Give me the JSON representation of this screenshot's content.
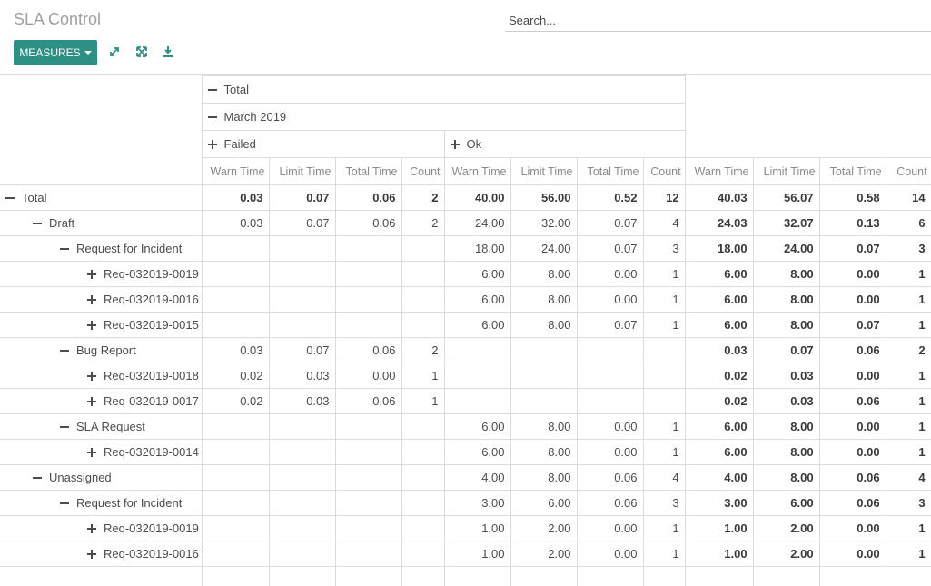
{
  "page": {
    "title": "SLA Control"
  },
  "search": {
    "placeholder": "Search..."
  },
  "toolbar": {
    "measures_label": "MEASURES"
  },
  "colors": {
    "accent": "#2e8f85"
  },
  "headers": {
    "level1": "Total",
    "level2": "March 2019",
    "groups": [
      "Failed",
      "Ok"
    ],
    "measures": [
      "Warn Time",
      "Limit Time",
      "Total Time",
      "Count"
    ]
  },
  "rows": [
    {
      "label": "Total",
      "indent": 0,
      "expanded": true,
      "failed": [
        "0.03",
        "0.07",
        "0.06",
        "2"
      ],
      "ok": [
        "40.00",
        "56.00",
        "0.52",
        "12"
      ],
      "total": [
        "40.03",
        "56.07",
        "0.58",
        "14"
      ]
    },
    {
      "label": "Draft",
      "indent": 1,
      "expanded": true,
      "failed": [
        "0.03",
        "0.07",
        "0.06",
        "2"
      ],
      "ok": [
        "24.00",
        "32.00",
        "0.07",
        "4"
      ],
      "total": [
        "24.03",
        "32.07",
        "0.13",
        "6"
      ]
    },
    {
      "label": "Request for Incident",
      "indent": 2,
      "expanded": true,
      "failed": [
        "",
        "",
        "",
        ""
      ],
      "ok": [
        "18.00",
        "24.00",
        "0.07",
        "3"
      ],
      "total": [
        "18.00",
        "24.00",
        "0.07",
        "3"
      ]
    },
    {
      "label": "Req-032019-0019",
      "indent": 3,
      "expanded": false,
      "failed": [
        "",
        "",
        "",
        ""
      ],
      "ok": [
        "6.00",
        "8.00",
        "0.00",
        "1"
      ],
      "total": [
        "6.00",
        "8.00",
        "0.00",
        "1"
      ]
    },
    {
      "label": "Req-032019-0016",
      "indent": 3,
      "expanded": false,
      "failed": [
        "",
        "",
        "",
        ""
      ],
      "ok": [
        "6.00",
        "8.00",
        "0.00",
        "1"
      ],
      "total": [
        "6.00",
        "8.00",
        "0.00",
        "1"
      ]
    },
    {
      "label": "Req-032019-0015",
      "indent": 3,
      "expanded": false,
      "failed": [
        "",
        "",
        "",
        ""
      ],
      "ok": [
        "6.00",
        "8.00",
        "0.07",
        "1"
      ],
      "total": [
        "6.00",
        "8.00",
        "0.07",
        "1"
      ]
    },
    {
      "label": "Bug Report",
      "indent": 2,
      "expanded": true,
      "failed": [
        "0.03",
        "0.07",
        "0.06",
        "2"
      ],
      "ok": [
        "",
        "",
        "",
        ""
      ],
      "total": [
        "0.03",
        "0.07",
        "0.06",
        "2"
      ]
    },
    {
      "label": "Req-032019-0018",
      "indent": 3,
      "expanded": false,
      "failed": [
        "0.02",
        "0.03",
        "0.00",
        "1"
      ],
      "ok": [
        "",
        "",
        "",
        ""
      ],
      "total": [
        "0.02",
        "0.03",
        "0.00",
        "1"
      ]
    },
    {
      "label": "Req-032019-0017",
      "indent": 3,
      "expanded": false,
      "failed": [
        "0.02",
        "0.03",
        "0.06",
        "1"
      ],
      "ok": [
        "",
        "",
        "",
        ""
      ],
      "total": [
        "0.02",
        "0.03",
        "0.06",
        "1"
      ]
    },
    {
      "label": "SLA Request",
      "indent": 2,
      "expanded": true,
      "failed": [
        "",
        "",
        "",
        ""
      ],
      "ok": [
        "6.00",
        "8.00",
        "0.00",
        "1"
      ],
      "total": [
        "6.00",
        "8.00",
        "0.00",
        "1"
      ]
    },
    {
      "label": "Req-032019-0014",
      "indent": 3,
      "expanded": false,
      "failed": [
        "",
        "",
        "",
        ""
      ],
      "ok": [
        "6.00",
        "8.00",
        "0.00",
        "1"
      ],
      "total": [
        "6.00",
        "8.00",
        "0.00",
        "1"
      ]
    },
    {
      "label": "Unassigned",
      "indent": 1,
      "expanded": true,
      "failed": [
        "",
        "",
        "",
        ""
      ],
      "ok": [
        "4.00",
        "8.00",
        "0.06",
        "4"
      ],
      "total": [
        "4.00",
        "8.00",
        "0.06",
        "4"
      ]
    },
    {
      "label": "Request for Incident",
      "indent": 2,
      "expanded": true,
      "failed": [
        "",
        "",
        "",
        ""
      ],
      "ok": [
        "3.00",
        "6.00",
        "0.06",
        "3"
      ],
      "total": [
        "3.00",
        "6.00",
        "0.06",
        "3"
      ]
    },
    {
      "label": "Req-032019-0019",
      "indent": 3,
      "expanded": false,
      "failed": [
        "",
        "",
        "",
        ""
      ],
      "ok": [
        "1.00",
        "2.00",
        "0.00",
        "1"
      ],
      "total": [
        "1.00",
        "2.00",
        "0.00",
        "1"
      ]
    },
    {
      "label": "Req-032019-0016",
      "indent": 3,
      "expanded": false,
      "failed": [
        "",
        "",
        "",
        ""
      ],
      "ok": [
        "1.00",
        "2.00",
        "0.00",
        "1"
      ],
      "total": [
        "1.00",
        "2.00",
        "0.00",
        "1"
      ]
    },
    {
      "label": "",
      "indent": 3,
      "expanded": false,
      "failed": [
        "",
        "",
        "",
        ""
      ],
      "ok": [
        "",
        "",
        "",
        ""
      ],
      "total": [
        "",
        "",
        "",
        ""
      ]
    }
  ]
}
